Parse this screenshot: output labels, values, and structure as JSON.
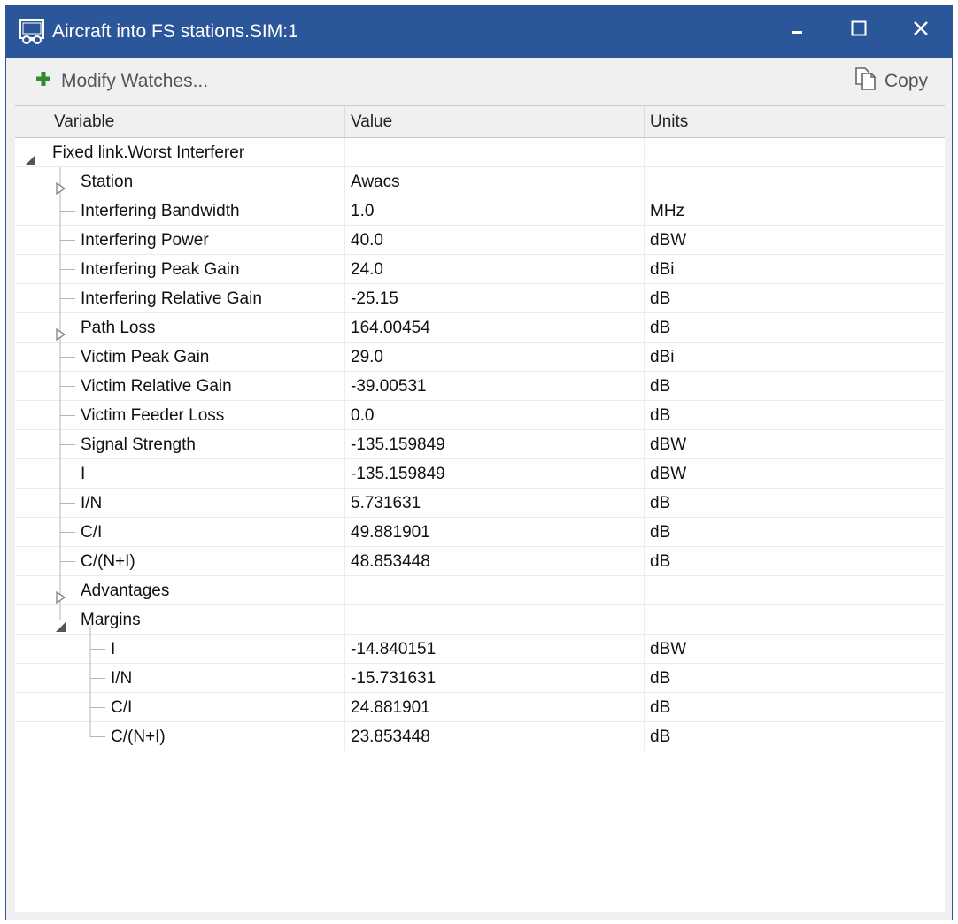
{
  "window": {
    "title": "Aircraft into FS stations.SIM:1"
  },
  "toolbar": {
    "modify_label": "Modify Watches...",
    "copy_label": "Copy"
  },
  "columns": {
    "variable": "Variable",
    "value": "Value",
    "units": "Units"
  },
  "rows": [
    {
      "label": "Fixed link.Worst Interferer",
      "value": "",
      "units": "",
      "level": 0,
      "state": "expanded"
    },
    {
      "label": "Station",
      "value": "Awacs",
      "units": "",
      "level": 1,
      "state": "collapsed"
    },
    {
      "label": "Interfering Bandwidth",
      "value": "1.0",
      "units": "MHz",
      "level": 1,
      "state": "leaf"
    },
    {
      "label": "Interfering Power",
      "value": "40.0",
      "units": "dBW",
      "level": 1,
      "state": "leaf"
    },
    {
      "label": "Interfering Peak Gain",
      "value": "24.0",
      "units": "dBi",
      "level": 1,
      "state": "leaf"
    },
    {
      "label": "Interfering Relative Gain",
      "value": "-25.15",
      "units": "dB",
      "level": 1,
      "state": "leaf"
    },
    {
      "label": "Path Loss",
      "value": "164.00454",
      "units": "dB",
      "level": 1,
      "state": "collapsed"
    },
    {
      "label": "Victim Peak Gain",
      "value": "29.0",
      "units": "dBi",
      "level": 1,
      "state": "leaf"
    },
    {
      "label": "Victim Relative Gain",
      "value": "-39.00531",
      "units": "dB",
      "level": 1,
      "state": "leaf"
    },
    {
      "label": "Victim Feeder Loss",
      "value": "0.0",
      "units": "dB",
      "level": 1,
      "state": "leaf"
    },
    {
      "label": "Signal Strength",
      "value": "-135.159849",
      "units": "dBW",
      "level": 1,
      "state": "leaf"
    },
    {
      "label": "I",
      "value": "-135.159849",
      "units": "dBW",
      "level": 1,
      "state": "leaf"
    },
    {
      "label": "I/N",
      "value": "5.731631",
      "units": "dB",
      "level": 1,
      "state": "leaf"
    },
    {
      "label": "C/I",
      "value": "49.881901",
      "units": "dB",
      "level": 1,
      "state": "leaf"
    },
    {
      "label": "C/(N+I)",
      "value": "48.853448",
      "units": "dB",
      "level": 1,
      "state": "leaf"
    },
    {
      "label": "Advantages",
      "value": "",
      "units": "",
      "level": 1,
      "state": "collapsed"
    },
    {
      "label": "Margins",
      "value": "",
      "units": "",
      "level": 1,
      "state": "expanded"
    },
    {
      "label": "I",
      "value": "-14.840151",
      "units": "dBW",
      "level": 2,
      "state": "leaf"
    },
    {
      "label": "I/N",
      "value": "-15.731631",
      "units": "dB",
      "level": 2,
      "state": "leaf"
    },
    {
      "label": "C/I",
      "value": "24.881901",
      "units": "dB",
      "level": 2,
      "state": "leaf"
    },
    {
      "label": "C/(N+I)",
      "value": "23.853448",
      "units": "dB",
      "level": 2,
      "state": "leaf",
      "last": true
    }
  ],
  "colors": {
    "titlebar": "#2b579a",
    "add_icon": "#2e8b2e"
  }
}
